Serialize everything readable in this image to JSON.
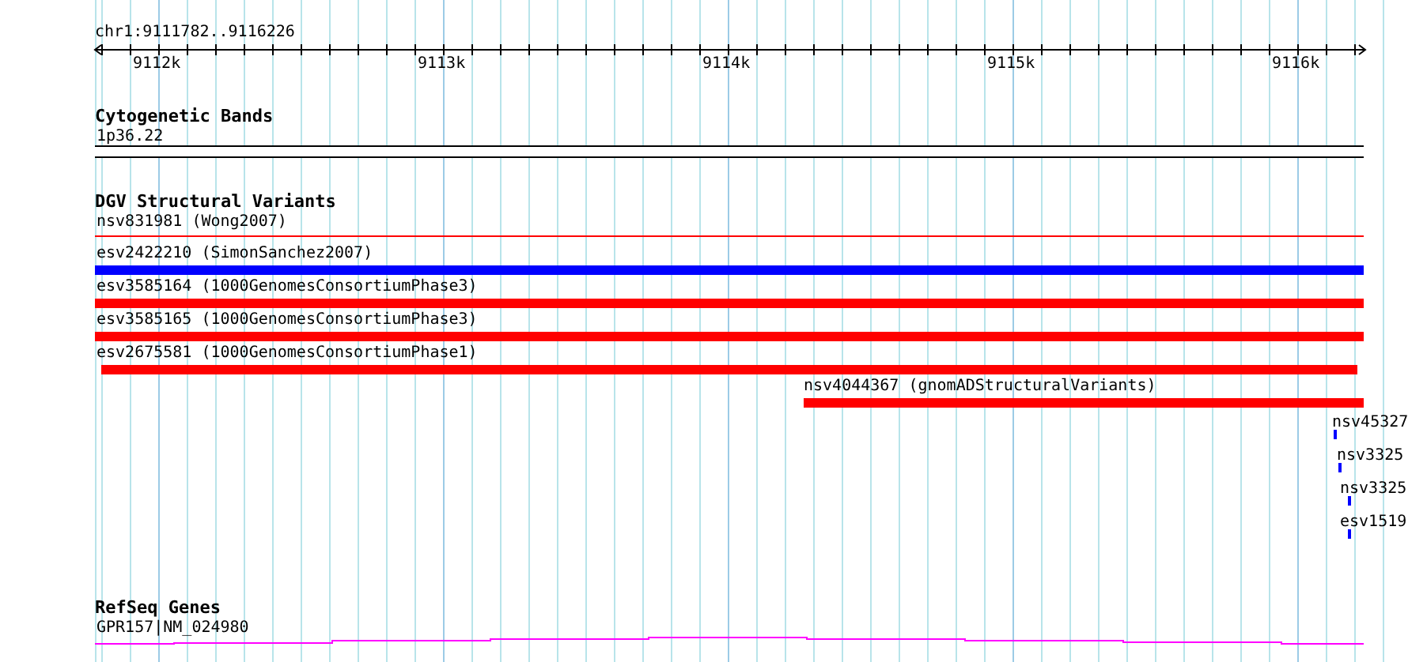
{
  "location": "chr1:9111782..9116226",
  "ruler": {
    "ticks": [
      "9112k",
      "9113k",
      "9114k",
      "9115k",
      "9116k"
    ]
  },
  "tracks": [
    {
      "kind": "bands",
      "title": "Cytogenetic Bands",
      "features": [
        {
          "label": "1p36.22"
        }
      ]
    },
    {
      "kind": "variants",
      "title": "DGV Structural Variants",
      "features": [
        {
          "label": "nsv831981 (Wong2007)",
          "color": "#ff0000"
        },
        {
          "label": "esv2422210 (SimonSanchez2007)",
          "color": "#0000ff"
        },
        {
          "label": "esv3585164 (1000GenomesConsortiumPhase3)",
          "color": "#ff0000"
        },
        {
          "label": "esv3585165 (1000GenomesConsortiumPhase3)",
          "color": "#ff0000"
        },
        {
          "label": "esv2675581 (1000GenomesConsortiumPhase1)",
          "color": "#ff0000"
        },
        {
          "label": "nsv4044367 (gnomADStructuralVariants)",
          "color": "#ff0000"
        },
        {
          "label": "nsv45327",
          "color": "#0000ff"
        },
        {
          "label": "nsv3325",
          "color": "#0000ff"
        },
        {
          "label": "nsv3325",
          "color": "#0000ff"
        },
        {
          "label": "esv1519",
          "color": "#0000ff"
        }
      ]
    },
    {
      "kind": "genes",
      "title": "RefSeq Genes",
      "features": [
        {
          "label": "GPR157|NM_024980"
        }
      ]
    }
  ]
}
